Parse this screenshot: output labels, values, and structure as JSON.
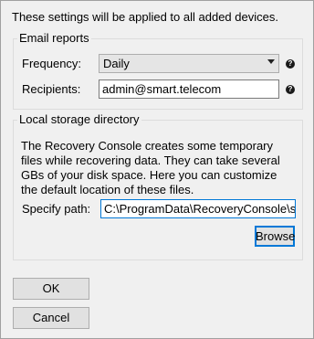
{
  "intro_text": "These settings will be applied to all added devices.",
  "email_reports": {
    "title": "Email reports",
    "frequency_label": "Frequency:",
    "frequency_value": "Daily",
    "recipients_label": "Recipients:",
    "recipients_value": "admin@smart.telecom",
    "help_glyph": "?"
  },
  "local_storage": {
    "title": "Local storage directory",
    "description": "The Recovery Console creates some temporary files while recovering data. They can take several GBs of your disk space. Here you can customize the default location of these files.",
    "path_label": "Specify path:",
    "path_value": "C:\\ProgramData\\RecoveryConsole\\sto",
    "browse_label": "Browse"
  },
  "buttons": {
    "ok": "OK",
    "cancel": "Cancel"
  },
  "colors": {
    "window_bg": "#f0f0f0",
    "focus_accent": "#0078d7"
  }
}
